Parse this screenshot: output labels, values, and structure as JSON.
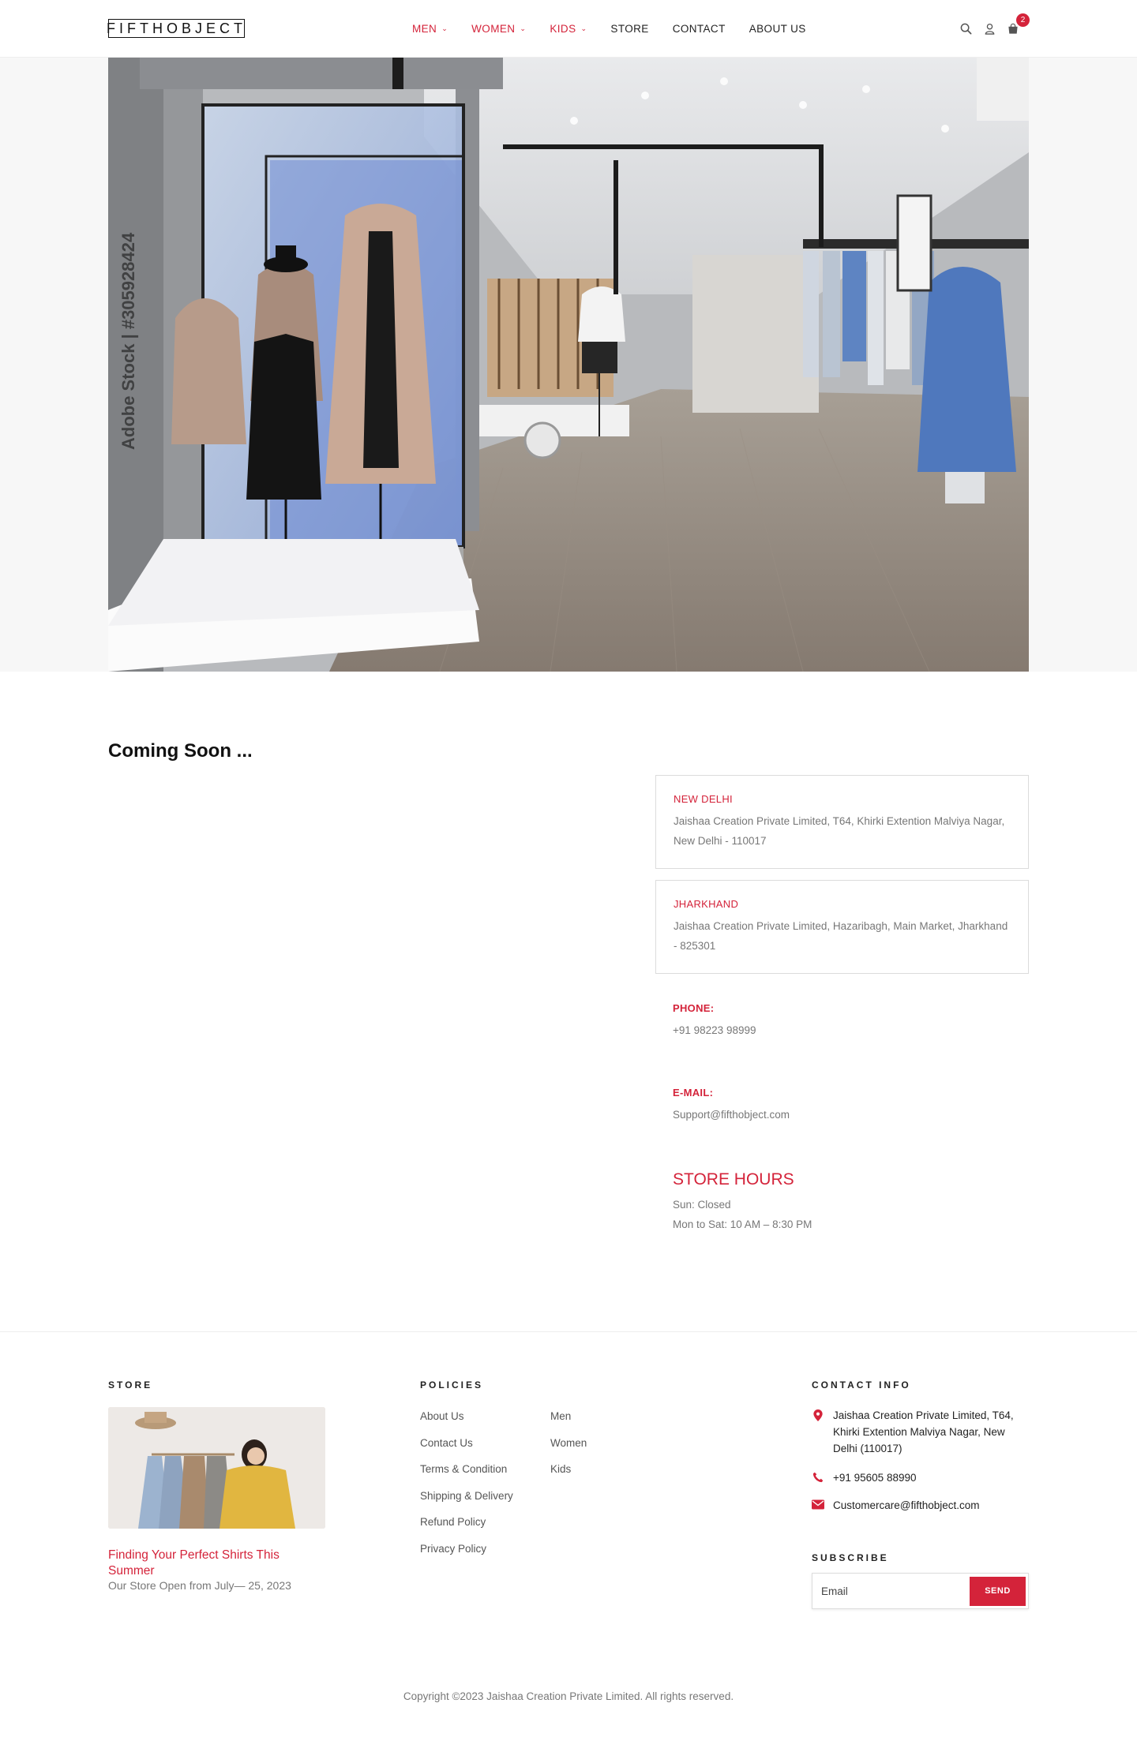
{
  "header": {
    "logo": "FIFTHOBJECT",
    "nav": [
      {
        "label": "MEN",
        "dropdown": true,
        "highlight": true
      },
      {
        "label": "WOMEN",
        "dropdown": true,
        "highlight": true
      },
      {
        "label": "KIDS",
        "dropdown": true,
        "highlight": true
      },
      {
        "label": "STORE",
        "dropdown": false,
        "highlight": false
      },
      {
        "label": "CONTACT",
        "dropdown": false,
        "highlight": false
      },
      {
        "label": "ABOUT US",
        "dropdown": false,
        "highlight": false
      }
    ],
    "icons": [
      "search-icon",
      "user-icon",
      "cart-icon"
    ],
    "cart_count": "2"
  },
  "hero": {
    "watermark": "Adobe Stock | #305928424"
  },
  "main": {
    "heading": "Coming Soon ...",
    "locations": [
      {
        "title": "NEW DELHI",
        "address": "Jaishaa Creation Private Limited, T64, Khirki Extention Malviya Nagar, New Delhi - 110017"
      },
      {
        "title": "JHARKHAND",
        "address": "Jaishaa Creation Private Limited, Hazaribagh, Main Market, Jharkhand - 825301"
      }
    ],
    "phone_label": "PHONE:",
    "phone": "+91 98223 98999",
    "email_label": "E-MAIL:",
    "email": "Support@fifthobject.com",
    "hours_title": "STORE HOURS",
    "hours": [
      "Sun: Closed",
      "Mon to Sat: 10 AM – 8:30 PM"
    ]
  },
  "footer": {
    "store_heading": "STORE",
    "post_title": "Finding Your Perfect Shirts This Summer",
    "post_date": "Our Store Open from July— 25, 2023",
    "policies_heading": "POLICIES",
    "policies": [
      "About Us",
      "Contact Us",
      "Terms & Condition",
      "Shipping & Delivery",
      "Refund Policy",
      "Privacy Policy"
    ],
    "categories": [
      "Men",
      "Women",
      "Kids"
    ],
    "contact_heading": "CONTACT INFO",
    "contact_address": "Jaishaa Creation Private Limited, T64, Khirki Extention Malviya Nagar, New Delhi (110017)",
    "contact_phone": "+91 95605 88990",
    "contact_email": "Customercare@fifthobject.com",
    "subscribe_heading": "SUBSCRIBE",
    "email_placeholder": "Email",
    "send_label": "SEND",
    "copyright": "Copyright ©2023 Jaishaa Creation Private Limited. All rights reserved."
  },
  "colors": {
    "accent": "#d4233a",
    "text": "#222222",
    "muted": "#777777"
  }
}
